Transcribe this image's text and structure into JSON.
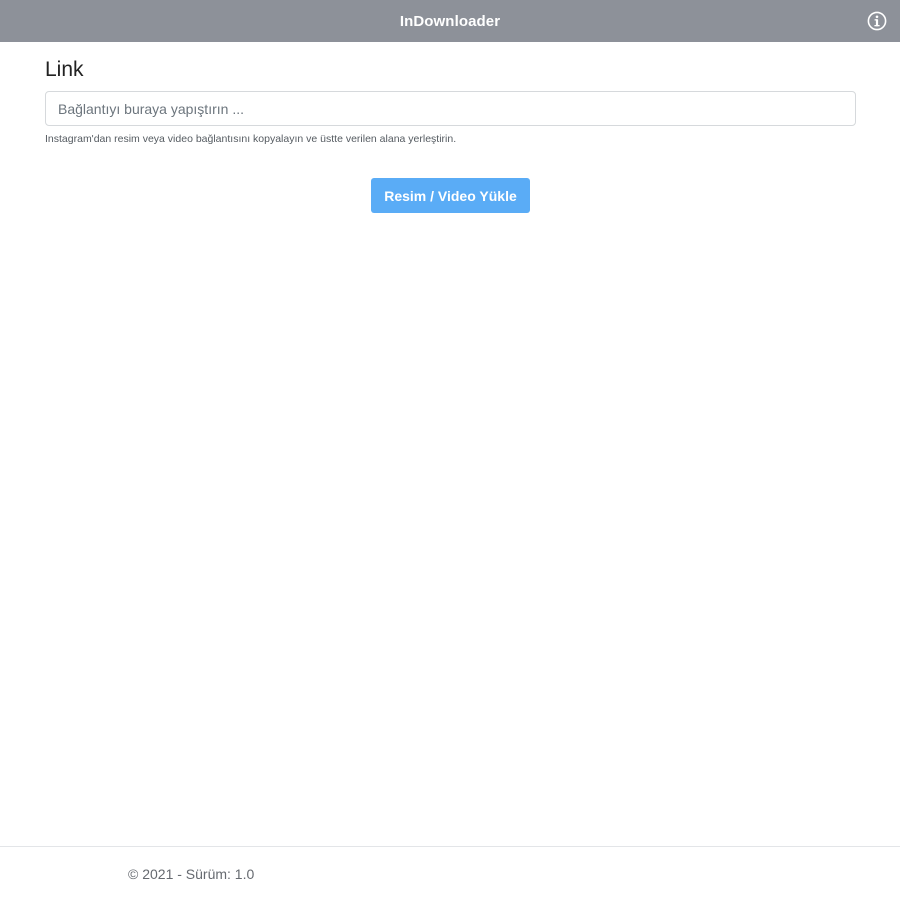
{
  "app": {
    "title": "InDownloader"
  },
  "form": {
    "label": "Link",
    "input_placeholder": "Bağlantıyı buraya yapıştırın ...",
    "input_value": "",
    "hint": "Instagram'dan resim veya video bağlantısını kopyalayın ve üstte verilen alana yerleştirin.",
    "button_label": "Resim / Video Yükle"
  },
  "footer": {
    "text": "© 2021 - Sürüm: 1.0"
  },
  "icons": {
    "info": "info-icon"
  },
  "colors": {
    "titlebar": "#8d9199",
    "button": "#5aacf6"
  }
}
